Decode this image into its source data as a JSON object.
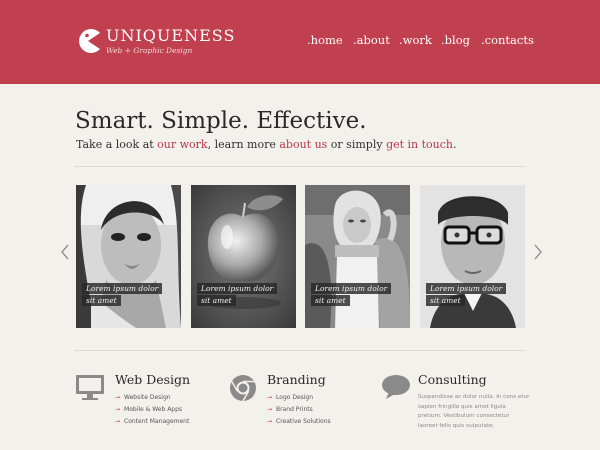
{
  "header": {
    "brand": "UNIQUENESS",
    "tagline": "Web + Graphic Design",
    "nav": [
      ".home",
      ".about",
      ".work",
      ".blog",
      ".contacts"
    ],
    "color": "#c1404f"
  },
  "hero": {
    "headline": "Smart. Simple. Effective.",
    "sub_before": "Take a look at ",
    "sub_link1": "our work",
    "sub_mid1": ", learn more ",
    "sub_link2": "about us",
    "sub_mid2": " or simply ",
    "sub_link3": "get in touch",
    "sub_end": ".",
    "link_color": "#b7374a"
  },
  "gallery": {
    "tiles": [
      {
        "caption_line1": "Lorem ipsum dolor",
        "caption_line2": "sit amet",
        "image": "woman-portrait"
      },
      {
        "caption_line1": "Lorem ipsum dolor",
        "caption_line2": "sit amet",
        "image": "glass-apple"
      },
      {
        "caption_line1": "Lorem ipsum dolor",
        "caption_line2": "sit amet",
        "image": "blonde-woman"
      },
      {
        "caption_line1": "Lorem ipsum dolor",
        "caption_line2": "sit amet",
        "image": "man-with-glasses"
      }
    ],
    "prev_icon": "chevron-left-icon",
    "next_icon": "chevron-right-icon"
  },
  "services": [
    {
      "title": "Web Design",
      "icon": "monitor-icon",
      "items": [
        "Website Design",
        "Mobile & Web Apps",
        "Content Management"
      ]
    },
    {
      "title": "Branding",
      "icon": "chrome-wheel-icon",
      "items": [
        "Logo Design",
        "Brand Prints",
        "Creative Solutions"
      ]
    },
    {
      "title": "Consulting",
      "icon": "speech-bubble-icon",
      "text": "Suspendisse ac dolor nulla. In cons etur sapien fringilla quis amet ligula pretium. Vestibulum consectetur laoreet felis quis vulputate."
    }
  ]
}
